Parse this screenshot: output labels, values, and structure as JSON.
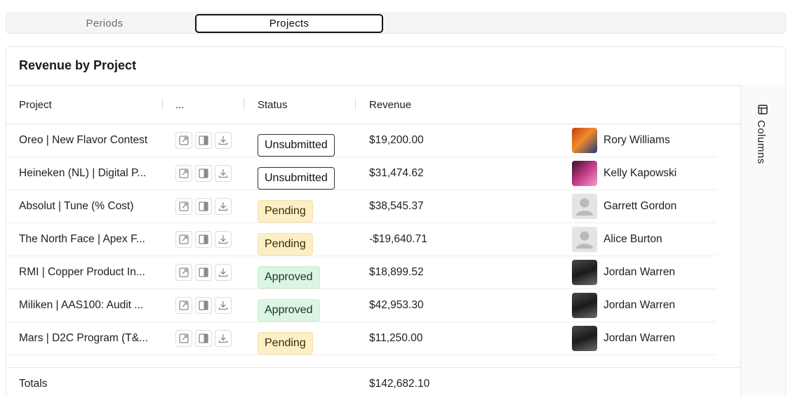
{
  "tabs": [
    {
      "label": "Periods",
      "active": false
    },
    {
      "label": "Projects",
      "active": true
    }
  ],
  "card": {
    "title": "Revenue by Project"
  },
  "table": {
    "headers": {
      "project": "Project",
      "actions": "...",
      "status": "Status",
      "revenue": "Revenue"
    },
    "rows": [
      {
        "project": "Oreo | New Flavor Contest",
        "status": "Unsubmitted",
        "revenue": "$19,200.00",
        "person": "Rory Williams",
        "avatar": "photo-avatar"
      },
      {
        "project": "Heineken (NL) | Digital P...",
        "status": "Unsubmitted",
        "revenue": "$31,474.62",
        "person": "Kelly Kapowski",
        "avatar": "photo-avatar"
      },
      {
        "project": "Absolut | Tune (% Cost)",
        "status": "Pending",
        "revenue": "$38,545.37",
        "person": "Garrett Gordon",
        "avatar": "default-avatar"
      },
      {
        "project": "The North Face | Apex F...",
        "status": "Pending",
        "revenue": "-$19,640.71",
        "person": "Alice Burton",
        "avatar": "default-avatar"
      },
      {
        "project": "RMI | Copper Product In...",
        "status": "Approved",
        "revenue": "$18,899.52",
        "person": "Jordan Warren",
        "avatar": "photo-avatar"
      },
      {
        "project": "Miliken | AAS100: Audit ...",
        "status": "Approved",
        "revenue": "$42,953.30",
        "person": "Jordan Warren",
        "avatar": "photo-avatar"
      },
      {
        "project": "Mars | D2C Program (T&...",
        "status": "Pending",
        "revenue": "$11,250.00",
        "person": "Jordan Warren",
        "avatar": "photo-avatar"
      }
    ],
    "row_actions": [
      "open-external-icon",
      "side-panel-icon",
      "download-icon"
    ],
    "totals": {
      "label": "Totals",
      "revenue": "$142,682.10"
    }
  },
  "side_panel": {
    "columns_label": "Columns",
    "icon": "table-columns-icon"
  },
  "colors": {
    "pending_bg": "#fcefc5",
    "approved_bg": "#dcf5e3",
    "unsubmitted_border": "#333333"
  }
}
